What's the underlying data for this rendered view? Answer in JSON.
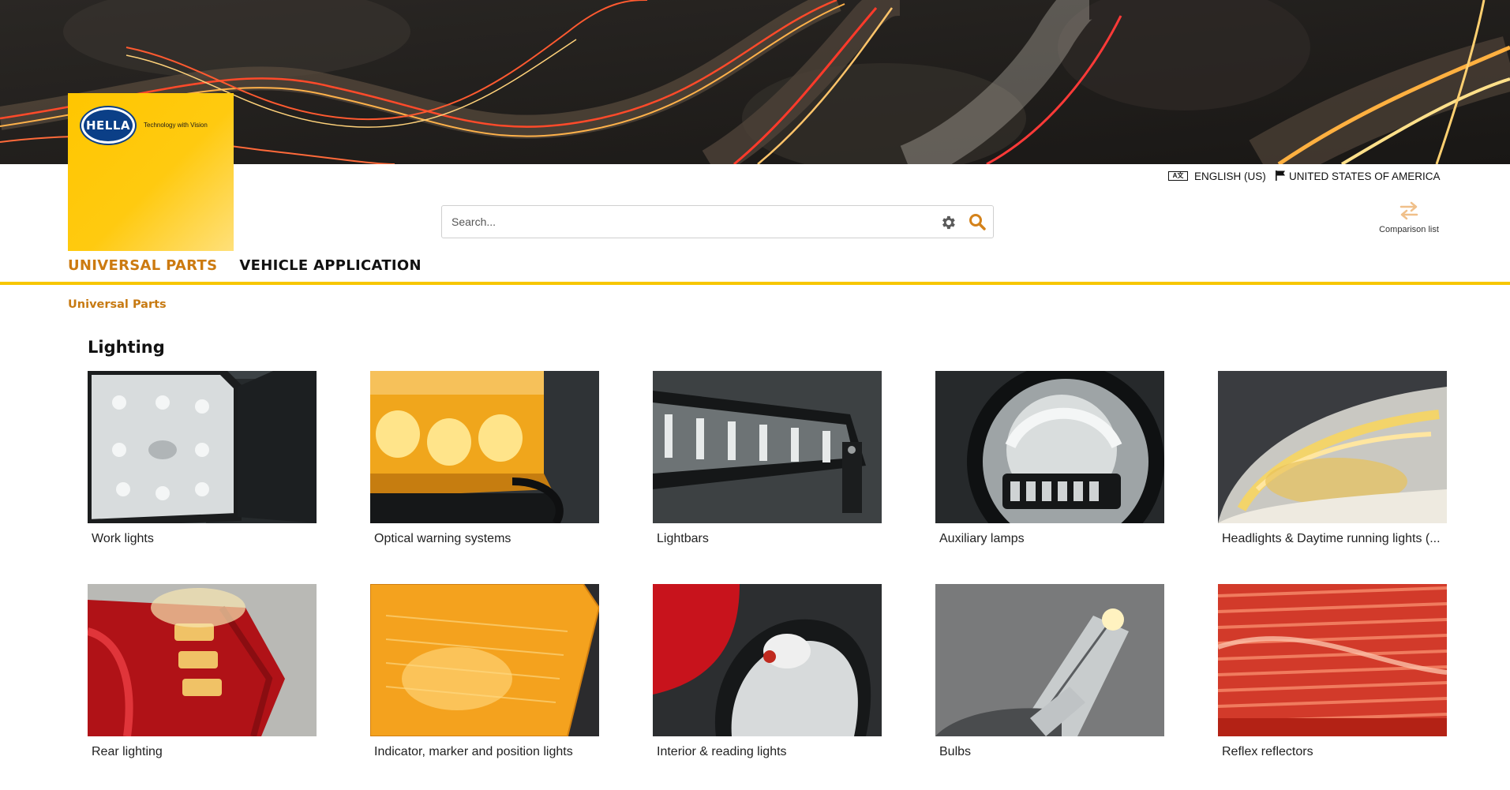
{
  "header": {
    "logo": {
      "wordmark": "HELLA",
      "tagline": "Technology with Vision"
    },
    "language": {
      "icon": "language-icon",
      "label": "ENGLISH (US)"
    },
    "country": {
      "icon": "flag-icon",
      "label": "UNITED STATES OF AMERICA"
    },
    "search": {
      "placeholder": "Search...",
      "value": "",
      "settings_icon": "gear-icon",
      "submit_icon": "search-icon"
    },
    "comparison": {
      "icon": "compare-arrows-icon",
      "label": "Comparison list"
    }
  },
  "nav": {
    "items": [
      {
        "label": "UNIVERSAL PARTS",
        "active": true
      },
      {
        "label": "VEHICLE APPLICATION",
        "active": false
      }
    ]
  },
  "breadcrumb": {
    "items": [
      "Universal Parts"
    ]
  },
  "section": {
    "title": "Lighting"
  },
  "categories": [
    {
      "label": "Work lights"
    },
    {
      "label": "Optical warning systems"
    },
    {
      "label": "Lightbars"
    },
    {
      "label": "Auxiliary lamps"
    },
    {
      "label": "Headlights & Daytime running lights (..."
    },
    {
      "label": "Rear lighting"
    },
    {
      "label": "Indicator, marker and position lights"
    },
    {
      "label": "Interior & reading lights"
    },
    {
      "label": "Bulbs"
    },
    {
      "label": "Reflex reflectors"
    }
  ],
  "colors": {
    "brand_yellow": "#ffc600",
    "accent_orange": "#cc7a10",
    "nav_rule": "#f7c600",
    "logo_blue": "#0b3f87"
  }
}
